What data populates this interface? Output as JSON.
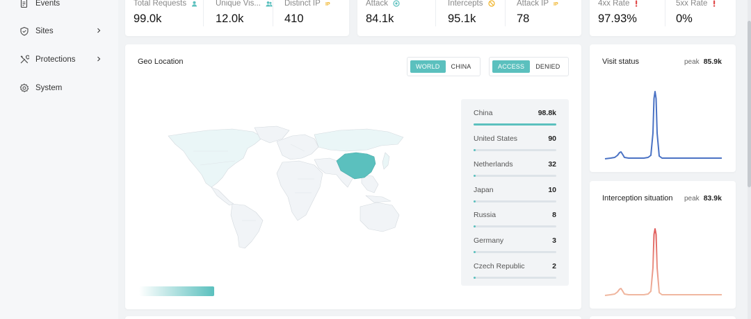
{
  "sidebar": {
    "items": [
      {
        "label": "Events",
        "icon": "document-icon",
        "has_chevron": false
      },
      {
        "label": "Sites",
        "icon": "shield-icon",
        "has_chevron": true
      },
      {
        "label": "Protections",
        "icon": "tools-icon",
        "has_chevron": true
      },
      {
        "label": "System",
        "icon": "gear-icon",
        "has_chevron": false
      }
    ]
  },
  "stats": {
    "group1": [
      {
        "label": "Total Requests",
        "value": "99.0k",
        "icon": "user-icon"
      },
      {
        "label": "Unique Vis...",
        "value": "12.0k",
        "icon": "users-icon"
      },
      {
        "label": "Distinct IP",
        "value": "410",
        "icon": "ip-icon"
      }
    ],
    "group2": [
      {
        "label": "Attack",
        "value": "84.1k",
        "icon": "target-icon"
      },
      {
        "label": "Intercepts",
        "value": "95.1k",
        "icon": "ban-icon"
      },
      {
        "label": "Attack IP",
        "value": "78",
        "icon": "ip-icon"
      }
    ],
    "group3": [
      {
        "label": "4xx Rate",
        "value": "97.93%",
        "icon": "alert-icon"
      },
      {
        "label": "5xx Rate",
        "value": "0%",
        "icon": "alert-icon"
      }
    ]
  },
  "geo": {
    "title": "Geo Location",
    "scope_toggle": [
      "WORLD",
      "CHINA"
    ],
    "scope_selected": "WORLD",
    "mode_toggle": [
      "ACCESS",
      "DENIED"
    ],
    "mode_selected": "ACCESS",
    "ranking": [
      {
        "country": "China",
        "count": "98.8k",
        "fraction": 1.0
      },
      {
        "country": "United States",
        "count": "90",
        "fraction": 0.02
      },
      {
        "country": "Netherlands",
        "count": "32",
        "fraction": 0.015
      },
      {
        "country": "Japan",
        "count": "10",
        "fraction": 0.01
      },
      {
        "country": "Russia",
        "count": "8",
        "fraction": 0.01
      },
      {
        "country": "Germany",
        "count": "3",
        "fraction": 0.01
      },
      {
        "country": "Czech Republic",
        "count": "2",
        "fraction": 0.01
      }
    ]
  },
  "visit_status": {
    "title": "Visit status",
    "peak_label": "peak",
    "peak_value": "85.9k"
  },
  "interception": {
    "title": "Interception situation",
    "peak_label": "peak",
    "peak_value": "83.9k"
  },
  "colors": {
    "accent": "#5bc0be",
    "map_highlight": "#5bc0be",
    "map_light": "#eaf6f7",
    "visit_line": "#4a72c4",
    "intercept_line_top": "#e05a5a",
    "intercept_line_bottom": "#f0b8a0",
    "alert": "#e04848",
    "ip_badge": "#f0b429"
  }
}
